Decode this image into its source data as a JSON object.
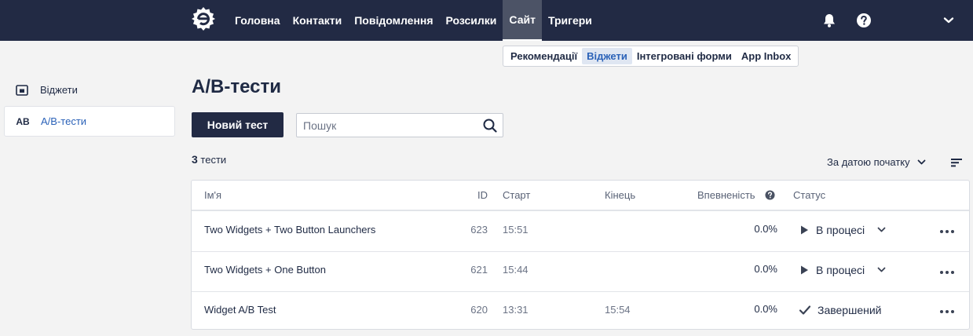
{
  "nav": {
    "items": [
      {
        "label": "Головна",
        "active": false
      },
      {
        "label": "Контакти",
        "active": false
      },
      {
        "label": "Повідомлення",
        "active": false
      },
      {
        "label": "Розсилки",
        "active": false
      },
      {
        "label": "Сайт",
        "active": true
      },
      {
        "label": "Тригери",
        "active": false
      }
    ],
    "icons": [
      "logo",
      "bell-icon",
      "help-icon",
      "chevron-down-icon"
    ]
  },
  "subnav": {
    "items": [
      {
        "label": "Рекомендації",
        "active": false
      },
      {
        "label": "Віджети",
        "active": true
      },
      {
        "label": "Інтегровані форми",
        "active": false
      },
      {
        "label": "App Inbox",
        "active": false
      }
    ]
  },
  "sidebar": {
    "items": [
      {
        "icon": "widget-icon",
        "label": "Віджети",
        "active": false
      },
      {
        "icon_text": "AB",
        "label": "A/B-тести",
        "active": true
      }
    ]
  },
  "page": {
    "title": "A/B-тести",
    "new_button": "Новий тест",
    "search_placeholder": "Пошук",
    "count_number": "3",
    "count_label": "тести",
    "sort_label": "За датою початку"
  },
  "table": {
    "headers": {
      "name": "Ім'я",
      "id": "ID",
      "start": "Старт",
      "end": "Кінець",
      "confidence": "Впевненість",
      "status": "Статус"
    },
    "rows": [
      {
        "name": "Two Widgets + Two Button Launchers",
        "id": "623",
        "start": "15:51",
        "end": "",
        "confidence": "0.0%",
        "status": "В процесі",
        "status_kind": "running"
      },
      {
        "name": "Two Widgets + One Button",
        "id": "621",
        "start": "15:44",
        "end": "",
        "confidence": "0.0%",
        "status": "В процесі",
        "status_kind": "running"
      },
      {
        "name": "Widget A/B Test",
        "id": "620",
        "start": "13:31",
        "end": "15:54",
        "confidence": "0.0%",
        "status": "Завершений",
        "status_kind": "finished"
      }
    ]
  },
  "colors": {
    "topbar": "#222a44",
    "active_nav": "#4c5366",
    "accent_link": "#2b62b8",
    "page_bg": "#f3f3f3"
  }
}
